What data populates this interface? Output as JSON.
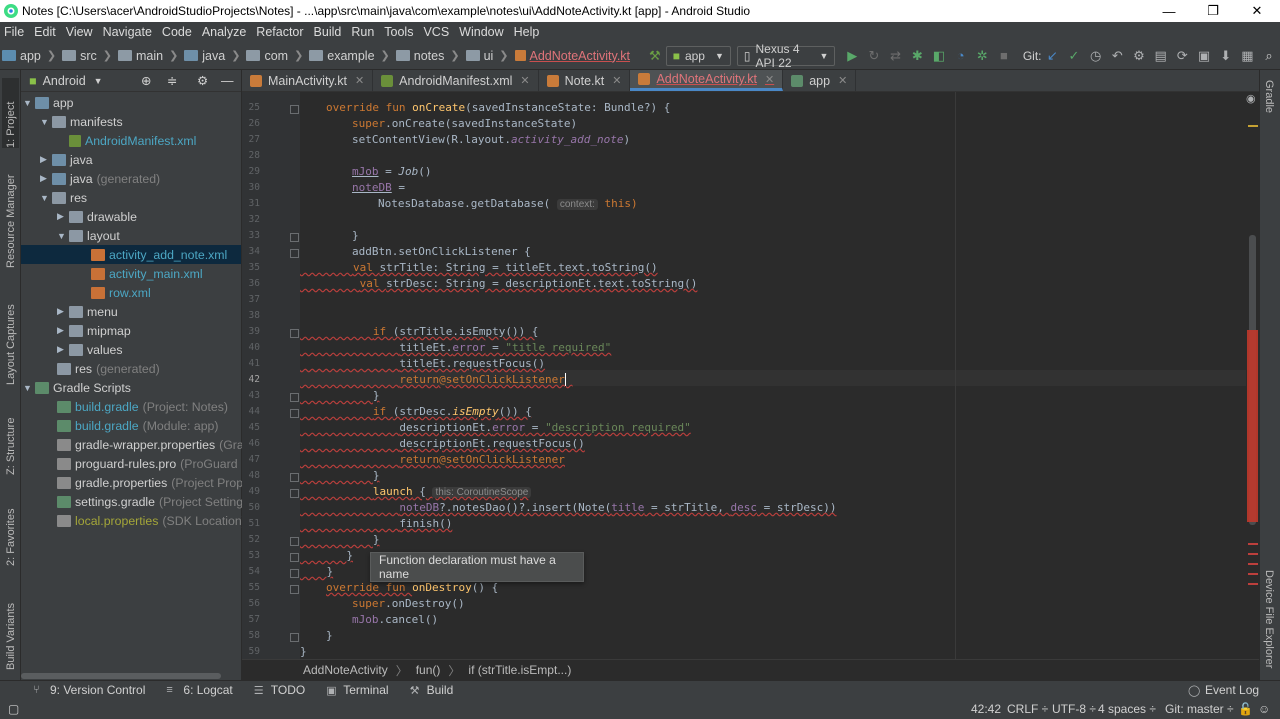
{
  "window": {
    "title": "Notes [C:\\Users\\acer\\AndroidStudioProjects\\Notes] - ...\\app\\src\\main\\java\\com\\example\\notes\\ui\\AddNoteActivity.kt [app] - Android Studio",
    "minimize": "—",
    "maximize": "❐",
    "close": "✕"
  },
  "menu": [
    "File",
    "Edit",
    "View",
    "Navigate",
    "Code",
    "Analyze",
    "Refactor",
    "Build",
    "Run",
    "Tools",
    "VCS",
    "Window",
    "Help"
  ],
  "breadcrumbs": [
    "app",
    "src",
    "main",
    "java",
    "com",
    "example",
    "notes",
    "ui",
    "AddNoteActivity.kt"
  ],
  "toolbar": {
    "run_config": "app",
    "device": "Nexus 4 API 22",
    "git_label": "Git:"
  },
  "left_tabs": [
    "1: Project",
    "Resource Manager",
    "Layout Captures",
    "Z: Structure",
    "2: Favorites",
    "Build Variants"
  ],
  "right_tabs": [
    "Gradle",
    "Device File Explorer"
  ],
  "project_view": {
    "mode": "Android",
    "tree": [
      {
        "label": "app",
        "note": ""
      },
      {
        "label": "manifests",
        "note": ""
      },
      {
        "label": "AndroidManifest.xml",
        "note": ""
      },
      {
        "label": "java",
        "note": ""
      },
      {
        "label": "java",
        "note": "(generated)"
      },
      {
        "label": "res",
        "note": ""
      },
      {
        "label": "drawable",
        "note": ""
      },
      {
        "label": "layout",
        "note": ""
      },
      {
        "label": "activity_add_note.xml",
        "note": ""
      },
      {
        "label": "activity_main.xml",
        "note": ""
      },
      {
        "label": "row.xml",
        "note": ""
      },
      {
        "label": "menu",
        "note": ""
      },
      {
        "label": "mipmap",
        "note": ""
      },
      {
        "label": "values",
        "note": ""
      },
      {
        "label": "res",
        "note": "(generated)"
      },
      {
        "label": "Gradle Scripts",
        "note": ""
      },
      {
        "label": "build.gradle",
        "note": "(Project: Notes)"
      },
      {
        "label": "build.gradle",
        "note": "(Module: app)"
      },
      {
        "label": "gradle-wrapper.properties",
        "note": "(Gradle"
      },
      {
        "label": "proguard-rules.pro",
        "note": "(ProGuard Rul"
      },
      {
        "label": "gradle.properties",
        "note": "(Project Properti"
      },
      {
        "label": "settings.gradle",
        "note": "(Project Settings)"
      },
      {
        "label": "local.properties",
        "note": "(SDK Location)"
      }
    ]
  },
  "editor_tabs": [
    {
      "label": "MainActivity.kt"
    },
    {
      "label": "AndroidManifest.xml"
    },
    {
      "label": "Note.kt"
    },
    {
      "label": "AddNoteActivity.kt"
    },
    {
      "label": "app"
    }
  ],
  "line_numbers": [
    "25",
    "26",
    "27",
    "28",
    "29",
    "30",
    "31",
    "32",
    "33",
    "34",
    "35",
    "36",
    "37",
    "38",
    "39",
    "40",
    "41",
    "42",
    "43",
    "44",
    "45",
    "46",
    "47",
    "48",
    "49",
    "50",
    "51",
    "52",
    "53",
    "54",
    "55",
    "56",
    "57",
    "58",
    "59"
  ],
  "code": {
    "l25": [
      "override fun ",
      "onCreate",
      "(savedInstanceState: Bundle?) {"
    ],
    "l26": [
      "super",
      ".onCreate(savedInstanceState)"
    ],
    "l27": [
      "setContentView(R.layout.",
      "activity_add_note",
      ")"
    ],
    "l29": [
      "mJob",
      " = ",
      "Job",
      "()"
    ],
    "l30": [
      "noteDB",
      " ="
    ],
    "l31": [
      "NotesDatabase.getDatabase(",
      "context:",
      " this)"
    ],
    "l33": [
      "}"
    ],
    "l34": [
      "addBtn.setOnClickListener {"
    ],
    "l35": [
      "val ",
      "strTitle: String = titleEt.text.toString()"
    ],
    "l36": [
      "val ",
      "strDesc: String = descriptionEt.text.toString()"
    ],
    "l39": [
      "if ",
      "(strTitle.isEmpty()) {"
    ],
    "l40": [
      "titleEt.",
      "error",
      " = ",
      "\"title required\""
    ],
    "l41": [
      "titleEt.requestFocus()"
    ],
    "l42": [
      "return",
      "@setOnClickListener"
    ],
    "l43": [
      "}"
    ],
    "l44": [
      "if ",
      "(strDesc.",
      "isEmpty",
      "()) {"
    ],
    "l45": [
      "descriptionEt.",
      "error",
      " = ",
      "\"description required\""
    ],
    "l46": [
      "descriptionEt.requestFocus()"
    ],
    "l47": [
      "return",
      "@setOnClickListener"
    ],
    "l48": [
      "}"
    ],
    "l49": [
      "launch",
      " {",
      "this: CoroutineScope"
    ],
    "l50": [
      "noteDB",
      "?.notesDao()?.insert(Note(",
      "title",
      " = strTitle, ",
      "desc",
      " = strDesc))"
    ],
    "l51": [
      "finish()"
    ],
    "l52": [
      "}"
    ],
    "l53": [
      "}"
    ],
    "l54": [
      "}"
    ],
    "l55": [
      "override fun ",
      "onDestroy",
      "() {"
    ],
    "l56": [
      "super",
      ".onDestroy()"
    ],
    "l57": [
      "mJob",
      ".cancel()"
    ],
    "l58": [
      "}"
    ],
    "l59": [
      "}"
    ]
  },
  "tooltip": "Function declaration must have a name",
  "code_breadcrumb": [
    "AddNoteActivity",
    "fun()",
    "if (strTitle.isEmpt...)"
  ],
  "bottom_tools": [
    {
      "label": "9: Version Control"
    },
    {
      "label": "6: Logcat"
    },
    {
      "label": "TODO"
    },
    {
      "label": "Terminal"
    },
    {
      "label": "Build"
    }
  ],
  "event_log": "Event Log",
  "status": {
    "position": "42:42",
    "line_sep": "CRLF ÷",
    "encoding": "UTF-8 ÷",
    "indent": "4 spaces ÷",
    "vcs": "Git: master ÷"
  },
  "colors": {
    "keyword": "#cc7832",
    "function": "#ffc66d",
    "string": "#6a8759",
    "property": "#9876aa",
    "error": "#bc3f3c",
    "accent": "#4a88c7"
  }
}
